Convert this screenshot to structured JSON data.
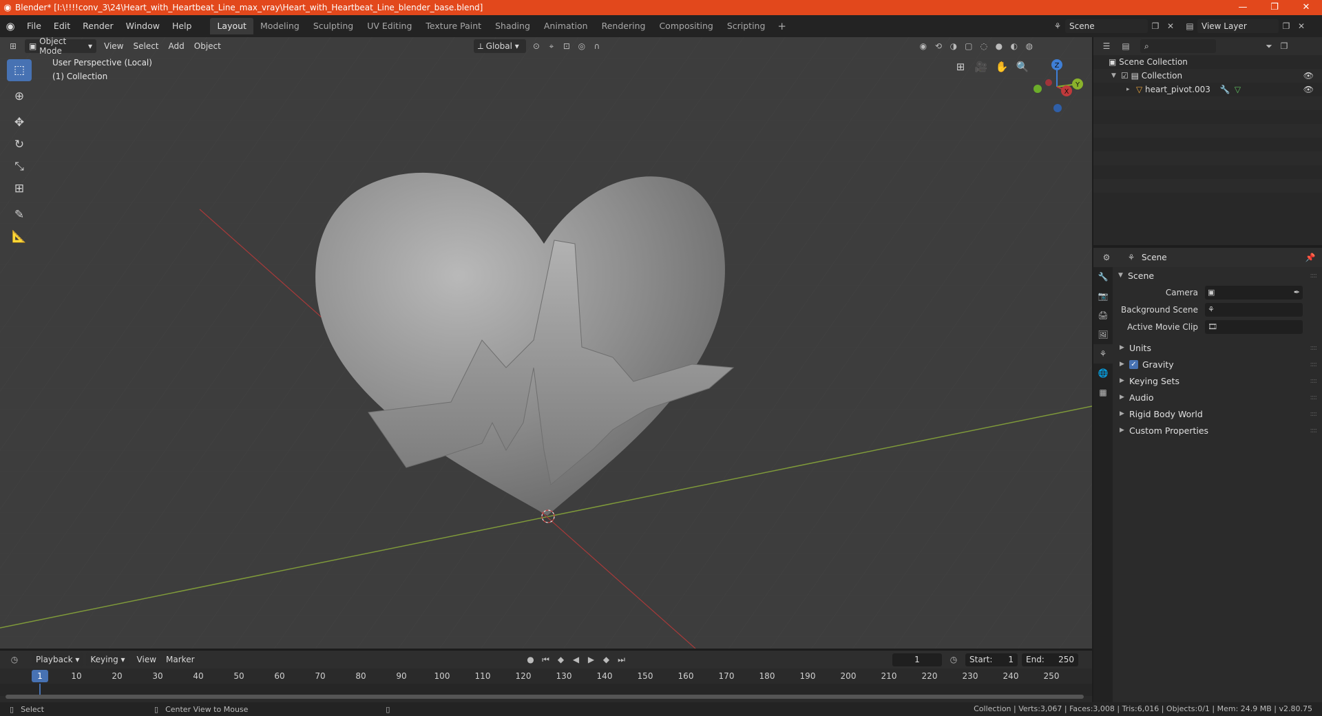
{
  "window": {
    "title": "Blender* [I:\\!!!!conv_3\\24\\Heart_with_Heartbeat_Line_max_vray\\Heart_with_Heartbeat_Line_blender_base.blend]",
    "controls": [
      "—",
      "❐",
      "✕"
    ]
  },
  "menu": [
    "File",
    "Edit",
    "Render",
    "Window",
    "Help"
  ],
  "workspaces": [
    "Layout",
    "Modeling",
    "Sculpting",
    "UV Editing",
    "Texture Paint",
    "Shading",
    "Animation",
    "Rendering",
    "Compositing",
    "Scripting"
  ],
  "active_workspace": "Layout",
  "scene_selector": {
    "scene": "Scene",
    "view_layer": "View Layer"
  },
  "viewport": {
    "mode": "Object Mode",
    "menus": [
      "View",
      "Select",
      "Add",
      "Object"
    ],
    "transform_orientation": "Global",
    "overlay_line1": "User Perspective (Local)",
    "overlay_line2": "(1) Collection",
    "gizmo": {
      "z": "Z",
      "y": "Y",
      "x": "X"
    }
  },
  "timeline": {
    "menus": [
      "Playback",
      "Keying",
      "View",
      "Marker"
    ],
    "current_frame": "1",
    "start_label": "Start:",
    "start": "1",
    "end_label": "End:",
    "end": "250",
    "ticks": [
      "10",
      "20",
      "30",
      "40",
      "50",
      "60",
      "70",
      "80",
      "90",
      "100",
      "110",
      "120",
      "130",
      "140",
      "150",
      "160",
      "170",
      "180",
      "190",
      "200",
      "210",
      "220",
      "230",
      "240",
      "250"
    ]
  },
  "statusbar": {
    "left1": "Select",
    "left2": "Center View to Mouse",
    "right": "Collection | Verts:3,067 | Faces:3,008 | Tris:6,016 | Objects:0/1 | Mem: 24.9 MB | v2.80.75"
  },
  "outliner": {
    "root": "Scene Collection",
    "collection": "Collection",
    "object": "heart_pivot.003"
  },
  "properties": {
    "header": "Scene",
    "panel": "Scene",
    "fields": [
      {
        "label": "Camera"
      },
      {
        "label": "Background Scene"
      },
      {
        "label": "Active Movie Clip"
      }
    ],
    "subpanels": [
      "Units",
      "Gravity",
      "Keying Sets",
      "Audio",
      "Rigid Body World",
      "Custom Properties"
    ]
  },
  "colors": {
    "accent": "#4772b3",
    "titlebar": "#e2481c",
    "x_axis": "#c0393b",
    "y_axis": "#8ab22b",
    "z_axis": "#3f7fd6"
  }
}
